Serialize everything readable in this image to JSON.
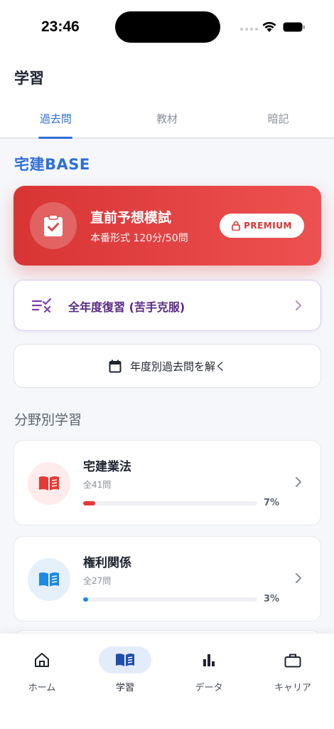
{
  "status_bar": {
    "time": "23:46"
  },
  "header": {
    "title": "学習"
  },
  "tabs": [
    {
      "label": "過去問",
      "active": true
    },
    {
      "label": "教材",
      "active": false
    },
    {
      "label": "暗記",
      "active": false
    }
  ],
  "brand": {
    "title": "宅建BASE"
  },
  "premium_card": {
    "title": "直前予想模試",
    "subtitle": "本番形式 120分/50問",
    "badge": "PREMIUM",
    "icon": "clipboard-check-icon"
  },
  "review_card": {
    "label": "全年度復習 (苦手克服)",
    "icon": "list-check-icon"
  },
  "year_card": {
    "label": "年度別過去問を解く",
    "icon": "calendar-icon"
  },
  "section": {
    "title": "分野別学習"
  },
  "subjects": [
    {
      "name": "宅建業法",
      "count": "全41問",
      "percent": "7%",
      "progress": 0.07,
      "color": "#e53935",
      "icon": "book-icon"
    },
    {
      "name": "権利関係",
      "count": "全27問",
      "percent": "3%",
      "progress": 0.03,
      "color": "#1e88e5",
      "icon": "book-icon"
    }
  ],
  "bottom_nav": [
    {
      "label": "ホーム",
      "icon": "home-icon",
      "active": false
    },
    {
      "label": "学習",
      "icon": "book-icon",
      "active": true
    },
    {
      "label": "データ",
      "icon": "bar-chart-icon",
      "active": false
    },
    {
      "label": "キャリア",
      "icon": "briefcase-icon",
      "active": false
    }
  ],
  "colors": {
    "accent": "#2f6fd6",
    "premium": "#d83434",
    "review": "#5a2a86"
  }
}
